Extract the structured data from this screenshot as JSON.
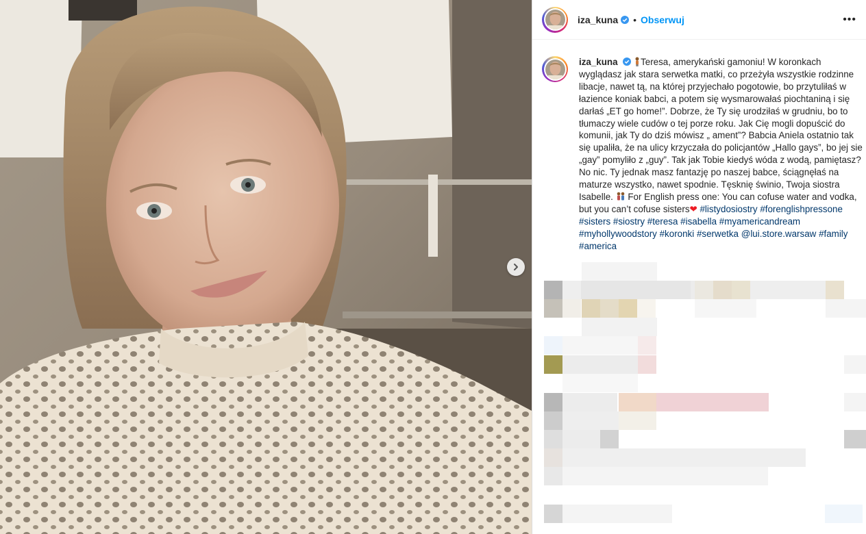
{
  "post": {
    "username": "iza_kuna",
    "separator": "•",
    "follow_label": "Obserwuj",
    "more_label": "•••",
    "caption": {
      "username": "iza_kuna",
      "text_main": "Teresa, amerykański gamoniu! W koronkach wyglądasz jak stara serwetka matki, co przeżyła wszystkie rodzinne libacje, nawet tą, na której przyjechało pogotowie, bo przytuliłaś w łazience koniak babci, a potem się wysmarowałaś piochtaniną i się darłaś „ET go home!”. Dobrze, że Ty się urodziłaś w grudniu, bo to tłumaczy wiele cudów o tej porze roku. Jak Cię mogli dopuścić do komunii, jak Ty do dziś mówisz „ ament”? Babcia Aniela ostatnio tak się upaliła, że na ulicy krzyczała do policjantów „Hallo gays”, bo jej sie „gay” pomyliło z „guy”. Tak jak Tobie kiedyś wóda z wodą, pamiętasz? No nic. Ty jednak masz fantazję po naszej babce, ściągnęłaś na maturze wszystko, nawet spodnie. Tęsknię świnio, Twoja siostra Isabelle.",
      "text_english": "For English press one: You can cofuse water and vodka, but you can’t cofuse sisters",
      "hashtags": [
        "#listydosiostry",
        "#forenglishpressone",
        "#sisters",
        "#siostry",
        "#teresa",
        "#isabella",
        "#myamericandream",
        "#myhollywoodstory",
        "#koronki",
        "#serwetka",
        "@lui.store.warsaw",
        "#family",
        "#america"
      ]
    }
  },
  "icons": {
    "verified": "verified-badge-icon",
    "next": "chevron-right-icon",
    "heart": "red-heart-emoji",
    "person": "woman-emoji",
    "couple": "two-women-emoji"
  },
  "colors": {
    "follow": "#0095f6",
    "hashtag": "#00376b",
    "verified": "#3897f0"
  }
}
